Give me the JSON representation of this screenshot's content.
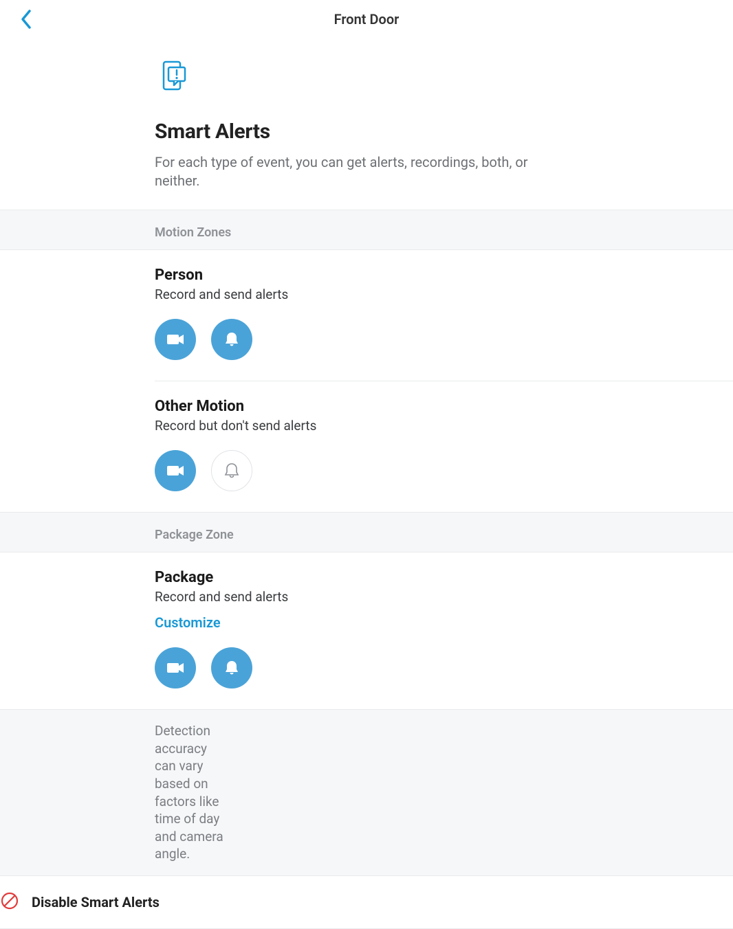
{
  "header": {
    "title": "Front Door"
  },
  "hero": {
    "title": "Smart Alerts",
    "description": "For each type of event, you can get alerts, recordings, both, or neither."
  },
  "sections": {
    "motion_zones": {
      "label": "Motion Zones",
      "events": {
        "person": {
          "title": "Person",
          "subtitle": "Record and send alerts",
          "record_active": true,
          "alert_active": true
        },
        "other_motion": {
          "title": "Other Motion",
          "subtitle": "Record but don't send alerts",
          "record_active": true,
          "alert_active": false
        }
      }
    },
    "package_zone": {
      "label": "Package Zone",
      "events": {
        "package": {
          "title": "Package",
          "subtitle": "Record and send alerts",
          "customize_label": "Customize",
          "record_active": true,
          "alert_active": true
        }
      }
    }
  },
  "footer": {
    "note": "Detection accuracy can vary based on factors like time of day and camera angle.",
    "disable_label": "Disable Smart Alerts"
  },
  "colors": {
    "accent": "#1998d5",
    "toggle_on": "#4aa3d8",
    "danger": "#e23b3b"
  }
}
